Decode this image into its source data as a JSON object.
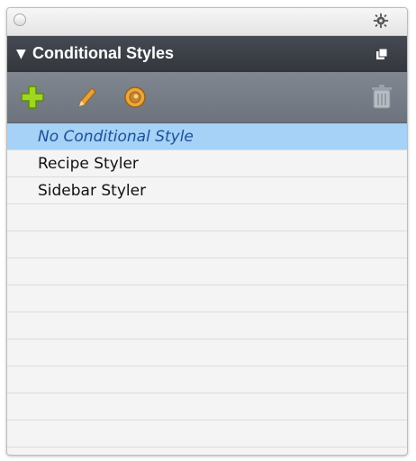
{
  "panel": {
    "title_triangle": "▼",
    "title": "Conditional Styles"
  },
  "toolbar": {
    "icons": [
      "plus-icon",
      "pencil-icon",
      "palette-icon",
      "trash-icon"
    ]
  },
  "list": {
    "items": [
      {
        "label": "No Conditional Style",
        "selected": true
      },
      {
        "label": "Recipe Styler",
        "selected": false
      },
      {
        "label": "Sidebar Styler",
        "selected": false
      }
    ]
  },
  "colors": {
    "header_bg": "#3d4148",
    "toolbar_bg": "#767d86",
    "selected_bg": "#a5d2f6",
    "selected_text": "#1c4f9a",
    "plus_green": "#9ed622",
    "pencil_orange": "#e8a23a"
  }
}
